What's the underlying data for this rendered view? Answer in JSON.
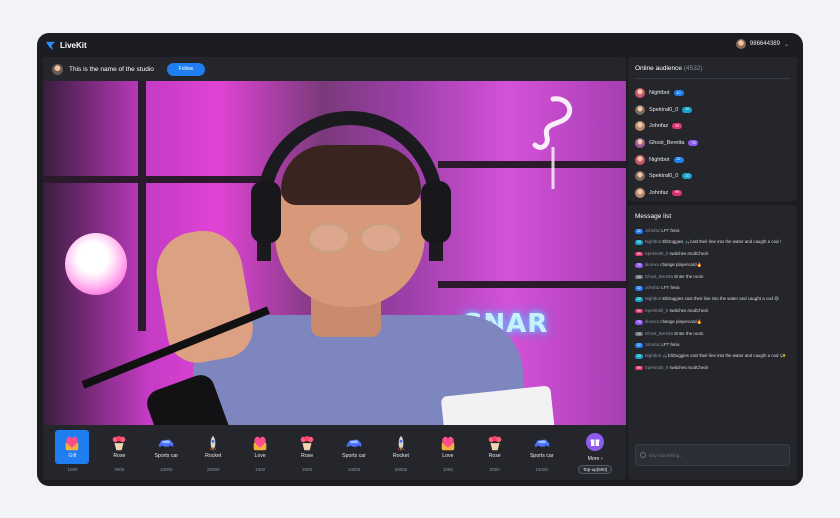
{
  "app": {
    "name": "LiveKit",
    "account_id": "986644389"
  },
  "studio": {
    "name": "This is the name of the studio",
    "follow_label": "Follow"
  },
  "gifts": [
    {
      "name": "Gift",
      "price": "1000",
      "icon": "heart-box-icon",
      "selected": true
    },
    {
      "name": "Rose",
      "price": "3000",
      "icon": "rose-icon"
    },
    {
      "name": "Sports car",
      "price": "10000",
      "icon": "sports-car-icon"
    },
    {
      "name": "Rocket",
      "price": "20000",
      "icon": "rocket-icon"
    },
    {
      "name": "Love",
      "price": "1000",
      "icon": "heart-box-icon"
    },
    {
      "name": "Rose",
      "price": "2000",
      "icon": "rose-icon"
    },
    {
      "name": "Sports car",
      "price": "10000",
      "icon": "sports-car-icon"
    },
    {
      "name": "Rocket",
      "price": "20000",
      "icon": "rocket-icon"
    },
    {
      "name": "Love",
      "price": "1000",
      "icon": "heart-box-icon"
    },
    {
      "name": "Rose",
      "price": "2000",
      "icon": "rose-icon"
    },
    {
      "name": "Sports car",
      "price": "10000",
      "icon": "sports-car-icon"
    }
  ],
  "more": {
    "label": "More",
    "topup_label": "Top-up(500)"
  },
  "audience": {
    "title": "Online audience",
    "count": "(4532)",
    "users": [
      {
        "name": "Nightbot",
        "badge": "40",
        "badge_color": "#1e7ef2"
      },
      {
        "name": "Spektral0_0",
        "badge": "20",
        "badge_color": "#16a3c9"
      },
      {
        "name": "Johnfaz",
        "badge": "99",
        "badge_color": "#e0336b"
      },
      {
        "name": "Ghost_Beretta",
        "badge": "75",
        "badge_color": "#8e5bf0"
      },
      {
        "name": "Nightbot",
        "badge": "32",
        "badge_color": "#1e7ef2"
      },
      {
        "name": "Spektral0_0",
        "badge": "20",
        "badge_color": "#16a3c9"
      },
      {
        "name": "Johnfaz",
        "badge": "99",
        "badge_color": "#e0336b"
      }
    ]
  },
  "messages": {
    "title": "Message list",
    "placeholder": "Say something...",
    "items": [
      {
        "badge": "32",
        "badge_color": "#1e7ef2",
        "user": "Johnfaz",
        "text": "LFT fenix"
      },
      {
        "badge": "20",
        "badge_color": "#16a3c9",
        "user": "Nightbot",
        "text": "EliDoggies 🎣cast their line into the water and caught a cod !"
      },
      {
        "badge": "99",
        "badge_color": "#e0336b",
        "user": "Spektral0_0",
        "text": "switches modCheck"
      },
      {
        "badge": "75",
        "badge_color": "#8e5bf0",
        "user": "diorexo",
        "text": "change playercard🔥"
      },
      {
        "badge": "10",
        "badge_color": "#6e737c",
        "user": "Ghost_Beretta",
        "text": "Enter the room"
      },
      {
        "badge": "32",
        "badge_color": "#1e7ef2",
        "user": "Johnfaz",
        "text": "LFT fenix"
      },
      {
        "badge": "20",
        "badge_color": "#16a3c9",
        "user": "Nightbot",
        "text": "EliDoggies cast their line into the water and caught a cod 😄"
      },
      {
        "badge": "99",
        "badge_color": "#e0336b",
        "user": "Spektral0_0",
        "text": "switches modCheck"
      },
      {
        "badge": "75",
        "badge_color": "#8e5bf0",
        "user": "diorexo",
        "text": "change playercard🔥"
      },
      {
        "badge": "10",
        "badge_color": "#6e737c",
        "user": "Ghost_Beretta",
        "text": "Enter the room"
      },
      {
        "badge": "32",
        "badge_color": "#1e7ef2",
        "user": "Johnfaz",
        "text": "LFT fenix"
      },
      {
        "badge": "20",
        "badge_color": "#16a3c9",
        "user": "Nightbot",
        "text": "🎣EliDoggies cast their line into the water and caught a cod !✨"
      },
      {
        "badge": "99",
        "badge_color": "#e0336b",
        "user": "Spektral0_0",
        "text": "switches modCheck"
      }
    ]
  },
  "colors": {
    "accent": "#1e7ef2",
    "background": "#1b1d22",
    "panel": "#24262c"
  }
}
